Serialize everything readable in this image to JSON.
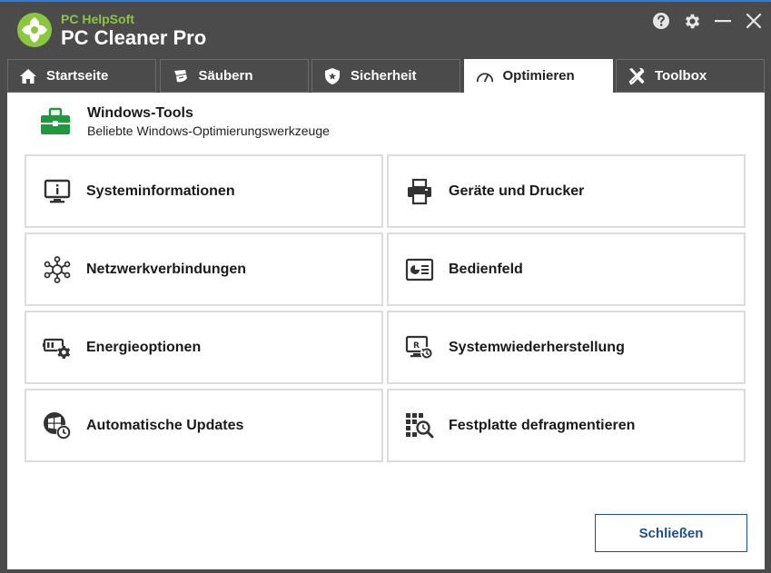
{
  "brand": {
    "company": "PC HelpSoft",
    "product": "PC Cleaner Pro",
    "accent_color": "#8cc63f"
  },
  "window_controls": [
    {
      "icon": "help-icon"
    },
    {
      "icon": "gear-icon"
    },
    {
      "icon": "minimize-icon"
    },
    {
      "icon": "close-icon"
    }
  ],
  "tabs": [
    {
      "label": "Startseite",
      "icon": "home-icon",
      "active": false
    },
    {
      "label": "Säubern",
      "icon": "broom-icon",
      "active": false
    },
    {
      "label": "Sicherheit",
      "icon": "shield-icon",
      "active": false
    },
    {
      "label": "Optimieren",
      "icon": "speedometer-icon",
      "active": true
    },
    {
      "label": "Toolbox",
      "icon": "tools-icon",
      "active": false
    }
  ],
  "section": {
    "title": "Windows-Tools",
    "subtitle": "Beliebte Windows-Optimierungswerkzeuge",
    "icon": "toolbox-icon",
    "icon_color": "#1e9a3c"
  },
  "tools": [
    {
      "label": "Systeminformationen",
      "icon": "monitor-info-icon"
    },
    {
      "label": "Geräte und Drucker",
      "icon": "printer-icon"
    },
    {
      "label": "Netzwerkverbindungen",
      "icon": "network-icon"
    },
    {
      "label": "Bedienfeld",
      "icon": "control-panel-icon"
    },
    {
      "label": "Energieoptionen",
      "icon": "battery-settings-icon"
    },
    {
      "label": "Systemwiederherstellung",
      "icon": "system-restore-icon"
    },
    {
      "label": "Automatische Updates",
      "icon": "windows-update-icon"
    },
    {
      "label": "Festplatte defragmentieren",
      "icon": "defrag-icon"
    }
  ],
  "close_label": "Schließen"
}
